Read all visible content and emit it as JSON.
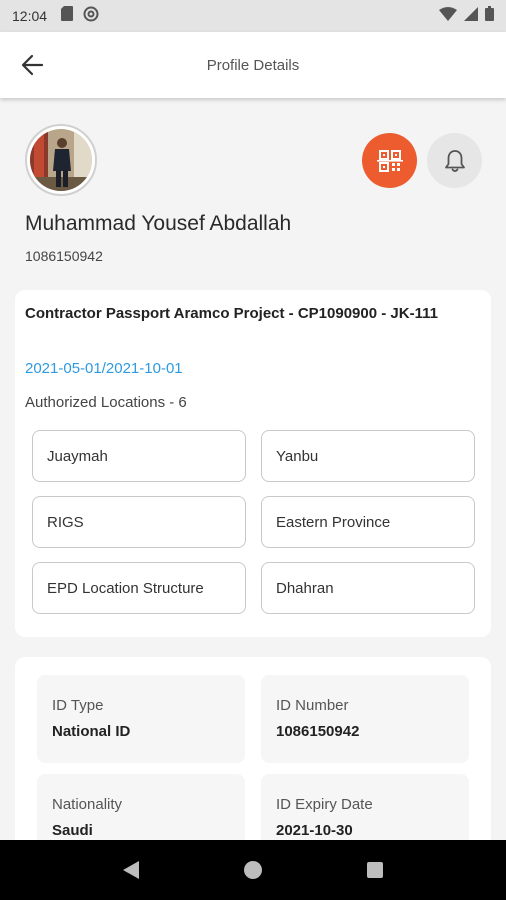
{
  "status_bar": {
    "time": "12:04",
    "icons": [
      "sd-card-icon",
      "at-sign-icon",
      "wifi-icon",
      "cell-signal-icon",
      "battery-icon"
    ]
  },
  "header": {
    "title": "Profile Details",
    "back_icon": "arrow-left-icon"
  },
  "profile": {
    "name": "Muhammad Yousef Abdallah",
    "id_number": "1086150942",
    "avatar": "person-photo",
    "qr_icon": "qr-code-icon",
    "bell_icon": "bell-icon",
    "accent_color": "#ec5c2e"
  },
  "pass": {
    "title": "Contractor Passport Aramco Project - CP1090900 - JK-111",
    "dates": "2021-05-01/2021-10-01",
    "authorized_locations_label": "Authorized Locations - 6",
    "locations": [
      "Juaymah",
      "Yanbu",
      "RIGS",
      "Eastern Province",
      "EPD Location Structure",
      "Dhahran"
    ],
    "dates_color": "#2f9ae0"
  },
  "details": {
    "id_type_label": "ID Type",
    "id_type_value": "National ID",
    "id_number_label": "ID Number",
    "id_number_value": "1086150942",
    "nationality_label": "Nationality",
    "nationality_value": "Saudi",
    "expiry_label": "ID Expiry Date",
    "expiry_value": "2021-10-30"
  },
  "nav": {
    "back_icon": "triangle-back-icon",
    "home_icon": "circle-home-icon",
    "recents_icon": "square-recents-icon"
  }
}
